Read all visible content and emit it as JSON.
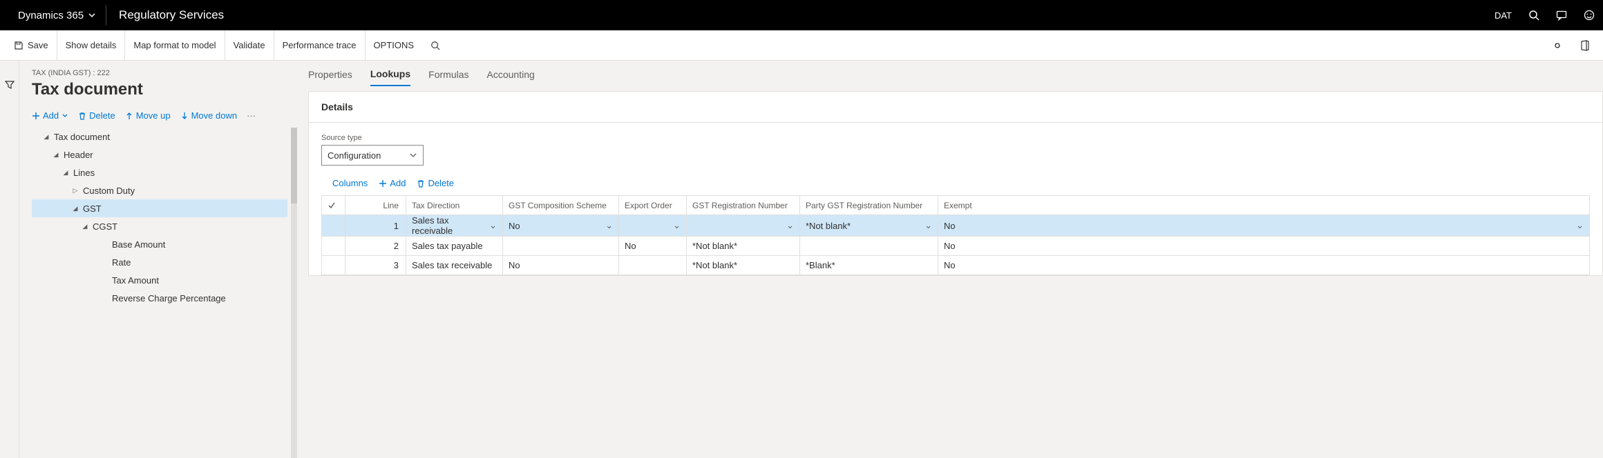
{
  "topbar": {
    "brand": "Dynamics 365",
    "module": "Regulatory Services",
    "company": "DAT"
  },
  "actionbar": {
    "save": "Save",
    "show_details": "Show details",
    "map_format": "Map format to model",
    "validate": "Validate",
    "perf_trace": "Performance trace",
    "options": "OPTIONS"
  },
  "page": {
    "breadcrumb": "TAX (INDIA GST) : 222",
    "title": "Tax document"
  },
  "tree_toolbar": {
    "add": "Add",
    "delete": "Delete",
    "move_up": "Move up",
    "move_down": "Move down"
  },
  "tree": {
    "n0": "Tax document",
    "n1": "Header",
    "n2": "Lines",
    "n3": "Custom Duty",
    "n4": "GST",
    "n5": "CGST",
    "n6": "Base Amount",
    "n7": "Rate",
    "n8": "Tax Amount",
    "n9": "Reverse Charge Percentage"
  },
  "tabs": {
    "properties": "Properties",
    "lookups": "Lookups",
    "formulas": "Formulas",
    "accounting": "Accounting"
  },
  "details": {
    "header": "Details",
    "source_type_label": "Source type",
    "source_type_value": "Configuration"
  },
  "grid_toolbar": {
    "columns": "Columns",
    "add": "Add",
    "delete": "Delete"
  },
  "grid": {
    "h_line": "Line",
    "h_tax_direction": "Tax Direction",
    "h_gst_comp": "GST Composition Scheme",
    "h_export": "Export Order",
    "h_gst_reg": "GST Registration Number",
    "h_party_gst_reg": "Party GST Registration Number",
    "h_exempt": "Exempt",
    "r1": {
      "line": "1",
      "tax_direction": "Sales tax receivable",
      "gst_comp": "No",
      "export": "",
      "gst_reg": "",
      "party_gst_reg": "*Not blank*",
      "exempt": "No"
    },
    "r2": {
      "line": "2",
      "tax_direction": "Sales tax payable",
      "gst_comp": "",
      "export": "No",
      "gst_reg": "*Not blank*",
      "party_gst_reg": "",
      "exempt": "No"
    },
    "r3": {
      "line": "3",
      "tax_direction": "Sales tax receivable",
      "gst_comp": "No",
      "export": "",
      "gst_reg": "*Not blank*",
      "party_gst_reg": "*Blank*",
      "exempt": "No"
    }
  }
}
